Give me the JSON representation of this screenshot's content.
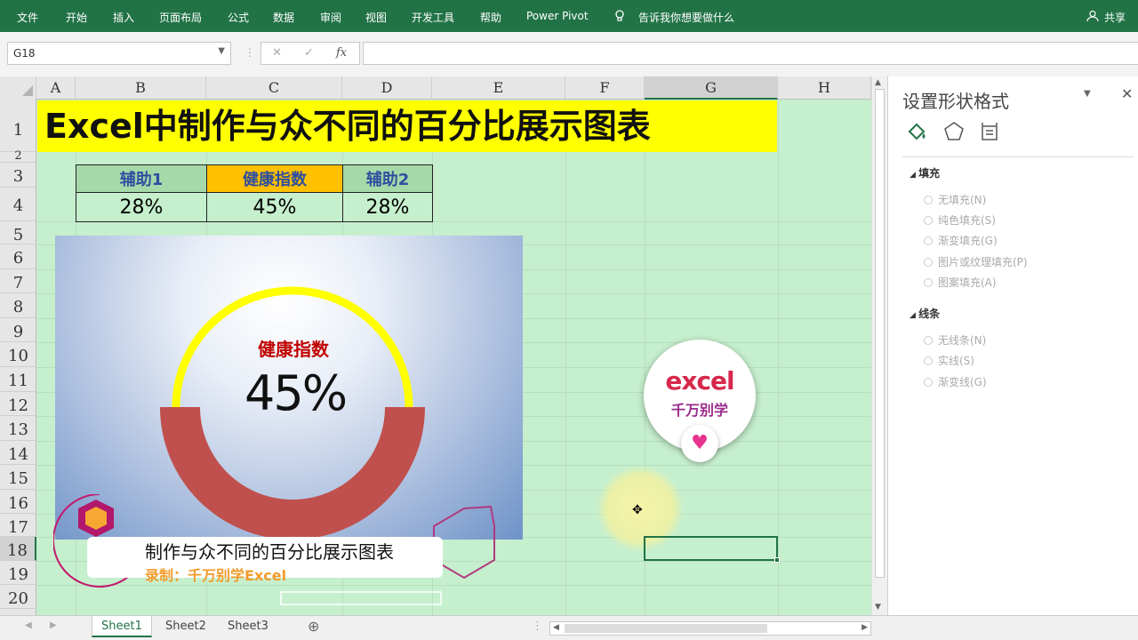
{
  "ribbon": {
    "tabs": [
      "文件",
      "开始",
      "插入",
      "页面布局",
      "公式",
      "数据",
      "审阅",
      "视图",
      "开发工具",
      "帮助",
      "Power Pivot"
    ],
    "tell_me": "告诉我你想要做什么",
    "share": "共享"
  },
  "formula_bar": {
    "name_box": "G18",
    "fx": "fx",
    "cancel": "✕",
    "confirm": "✓",
    "value": ""
  },
  "columns": [
    "A",
    "B",
    "C",
    "D",
    "E",
    "F",
    "G",
    "H"
  ],
  "rows": [
    "1",
    "2",
    "3",
    "4",
    "5",
    "6",
    "7",
    "8",
    "9",
    "10",
    "11",
    "12",
    "13",
    "14",
    "15",
    "16",
    "17",
    "18",
    "19",
    "20"
  ],
  "sheet": {
    "title": "Excel中制作与众不同的百分比展示图表",
    "table": {
      "headers": [
        "辅助1",
        "健康指数",
        "辅助2"
      ],
      "values": [
        "28%",
        "45%",
        "28%"
      ]
    }
  },
  "chart": {
    "label": "健康指数",
    "value_text": "45%",
    "colors": {
      "ring": "#ffff00",
      "arc": "#c0504d"
    }
  },
  "promo": {
    "title": "制作与众不同的百分比展示图表",
    "subtitle": "录制：千万别学Excel"
  },
  "badge": {
    "line1": "excel",
    "line2": "千万别学"
  },
  "panel": {
    "title": "设置形状格式",
    "fill_section": "填充",
    "fill_options": [
      "无填充(N)",
      "纯色填充(S)",
      "渐变填充(G)",
      "图片或纹理填充(P)",
      "图案填充(A)"
    ],
    "line_section": "线条",
    "line_options": [
      "无线条(N)",
      "实线(S)",
      "渐变线(G)"
    ]
  },
  "sheets": [
    "Sheet1",
    "Sheet2",
    "Sheet3"
  ],
  "active_sheet": "Sheet1"
}
